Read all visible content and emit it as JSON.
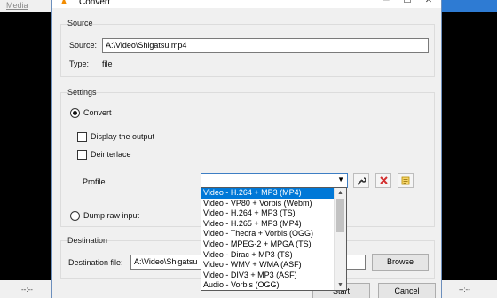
{
  "background": {
    "menu_label": "Media",
    "time_left": "--:--",
    "time_right": "--:--"
  },
  "dialog": {
    "title": "Convert",
    "minimize": "─",
    "maximize": "☐",
    "close": "✕"
  },
  "source": {
    "group_label": "Source",
    "source_label": "Source:",
    "source_value": "A:\\Video\\Shigatsu.mp4",
    "type_label": "Type:",
    "type_value": "file"
  },
  "settings": {
    "group_label": "Settings",
    "convert_label": "Convert",
    "display_output_label": "Display the output",
    "deinterlace_label": "Deinterlace",
    "profile_label": "Profile",
    "dump_raw_label": "Dump raw input"
  },
  "profile_options": [
    "Video - H.264 + MP3 (MP4)",
    "Video - VP80 + Vorbis (Webm)",
    "Video - H.264 + MP3 (TS)",
    "Video - H.265 + MP3 (MP4)",
    "Video - Theora + Vorbis (OGG)",
    "Video - MPEG-2 + MPGA (TS)",
    "Video - Dirac + MP3 (TS)",
    "Video - WMV + WMA (ASF)",
    "Video - DIV3 + MP3 (ASF)",
    "Audio - Vorbis (OGG)"
  ],
  "destination": {
    "group_label": "Destination",
    "file_label": "Destination file:",
    "file_value": "A:\\Video\\Shigatsu",
    "browse_label": "Browse"
  },
  "buttons": {
    "start_label": "Start",
    "cancel_label": "Cancel"
  },
  "colors": {
    "selection": "#0078d7",
    "delete_icon": "#d32f2f",
    "accent_border": "#3d7ec4"
  }
}
